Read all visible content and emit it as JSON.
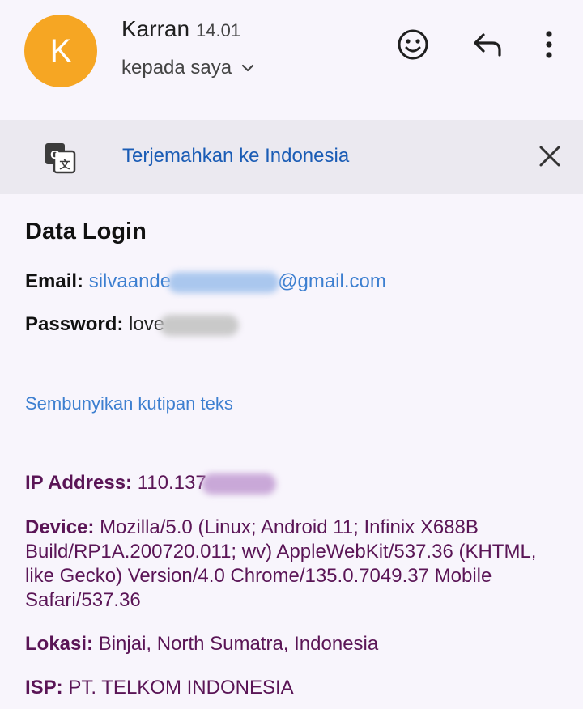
{
  "header": {
    "avatar_letter": "K",
    "sender_name": "Karran",
    "time": "14.01",
    "recipient_text": "kepada saya",
    "icons": [
      "smile-emoji-icon",
      "reply-icon",
      "more-vert-icon",
      "chevron-down-icon"
    ]
  },
  "translate": {
    "link_text": "Terjemahkan ke Indonesia",
    "icons": [
      "translate-icon",
      "close-icon"
    ]
  },
  "body": {
    "heading": "Data Login",
    "email_label": "Email:",
    "email_value_start": "silvaande",
    "email_value_end": "@gmail.com",
    "password_label": "Password:",
    "password_value_start": "love"
  },
  "quote": {
    "toggle_text": "Sembunyikan kutipan teks",
    "ip_label": "IP Address:",
    "ip_value_start": "110.137",
    "device_label": "Device:",
    "device_value": "Mozilla/5.0 (Linux; Android 11; Infinix X688B Build/RP1A.200720.011; wv) AppleWebKit/537.36 (KHTML, like Gecko) Version/4.0 Chrome/135.0.7049.37 Mobile Safari/537.36",
    "location_label": "Lokasi:",
    "location_value": "Binjai, North Sumatra, Indonesia",
    "isp_label": "ISP:",
    "isp_value": "PT. TELKOM INDONESIA"
  },
  "colors": {
    "avatar": "#f6a623",
    "link_blue": "#1a5cb5",
    "email_blue": "#3d7fd0",
    "quote_purple": "#5a1556",
    "translate_bar": "#ebe9f0",
    "page_bg": "#f8f5fc"
  }
}
